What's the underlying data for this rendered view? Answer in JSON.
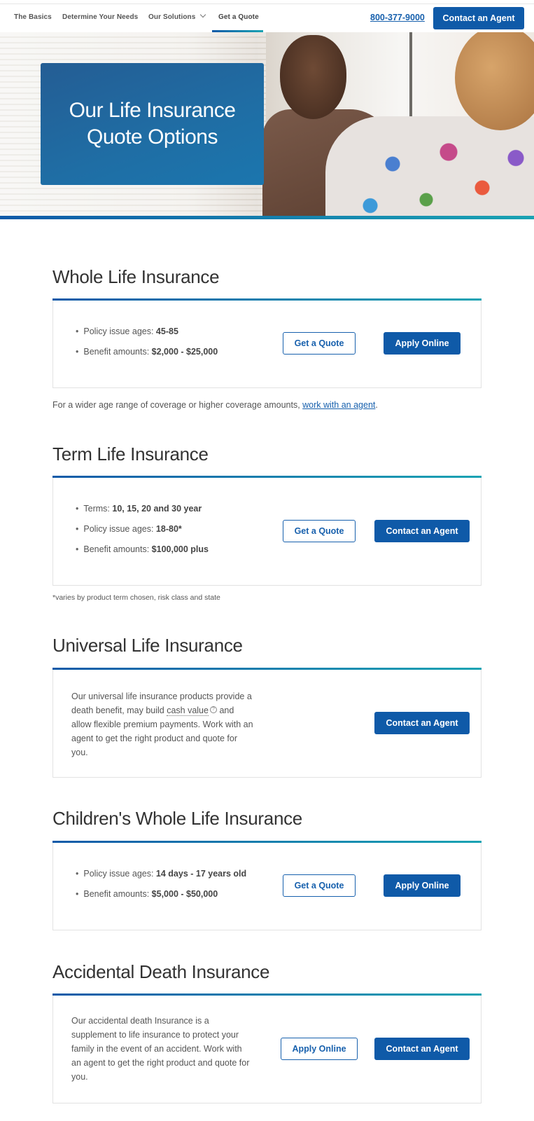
{
  "nav": {
    "items": [
      {
        "label": "The Basics"
      },
      {
        "label": "Determine Your Needs"
      },
      {
        "label": "Our Solutions",
        "icon": "chevron-down-icon"
      },
      {
        "label": "Get a Quote",
        "active": true
      }
    ],
    "phone": "800-377-9000",
    "cta_label": "Contact an Agent"
  },
  "hero": {
    "title_line1": "Our Life Insurance",
    "title_line2": "Quote Options"
  },
  "colors": {
    "brand_blue": "#0f5aa8",
    "accent_teal": "#1aa3b3",
    "link_blue": "#1760ad",
    "text": "#4a4a4a"
  },
  "sections": {
    "whole_life": {
      "title": "Whole Life Insurance",
      "bullets": [
        {
          "label": "Policy issue ages: ",
          "value": "45-85"
        },
        {
          "label": "Benefit amounts: ",
          "value": "$2,000 - $25,000"
        }
      ],
      "buttons": {
        "secondary": "Get a Quote",
        "primary": "Apply Online"
      },
      "note_text": "For a wider age range of coverage or higher coverage amounts, ",
      "note_link": "work with an agent",
      "note_end": "."
    },
    "term_life": {
      "title": "Term Life Insurance",
      "bullets": [
        {
          "label": "Terms: ",
          "value": "10, 15, 20 and 30 year"
        },
        {
          "label": "Policy issue ages: ",
          "value": "18-80*"
        },
        {
          "label": "Benefit amounts: ",
          "value": "$100,000 plus"
        }
      ],
      "buttons": {
        "secondary": "Get a Quote",
        "primary": "Contact an Agent"
      },
      "footnote": "*varies by product term chosen, risk class and state"
    },
    "universal_life": {
      "title": "Universal Life Insurance",
      "para_before": "Our universal life insurance products provide a death benefit, may build ",
      "para_term": "cash value",
      "para_after": " and allow flexible premium payments. Work with an agent to get the right product and quote for you.",
      "help_icon": "question-circle-icon",
      "buttons": {
        "primary": "Contact an Agent"
      }
    },
    "childrens_whole_life": {
      "title": "Children's Whole Life Insurance",
      "bullets": [
        {
          "label": "Policy issue ages: ",
          "value": "14 days - 17 years old"
        },
        {
          "label": "Benefit amounts: ",
          "value": "$5,000 - $50,000"
        }
      ],
      "buttons": {
        "secondary": "Get a Quote",
        "primary": "Apply Online"
      }
    },
    "accidental_death": {
      "title": "Accidental Death Insurance",
      "para": "Our accidental death Insurance is a supplement to life insurance to protect your family in the event of an accident. Work with an agent to get the right product and quote for you.",
      "buttons": {
        "secondary": "Apply Online",
        "primary": "Contact an Agent"
      }
    }
  }
}
